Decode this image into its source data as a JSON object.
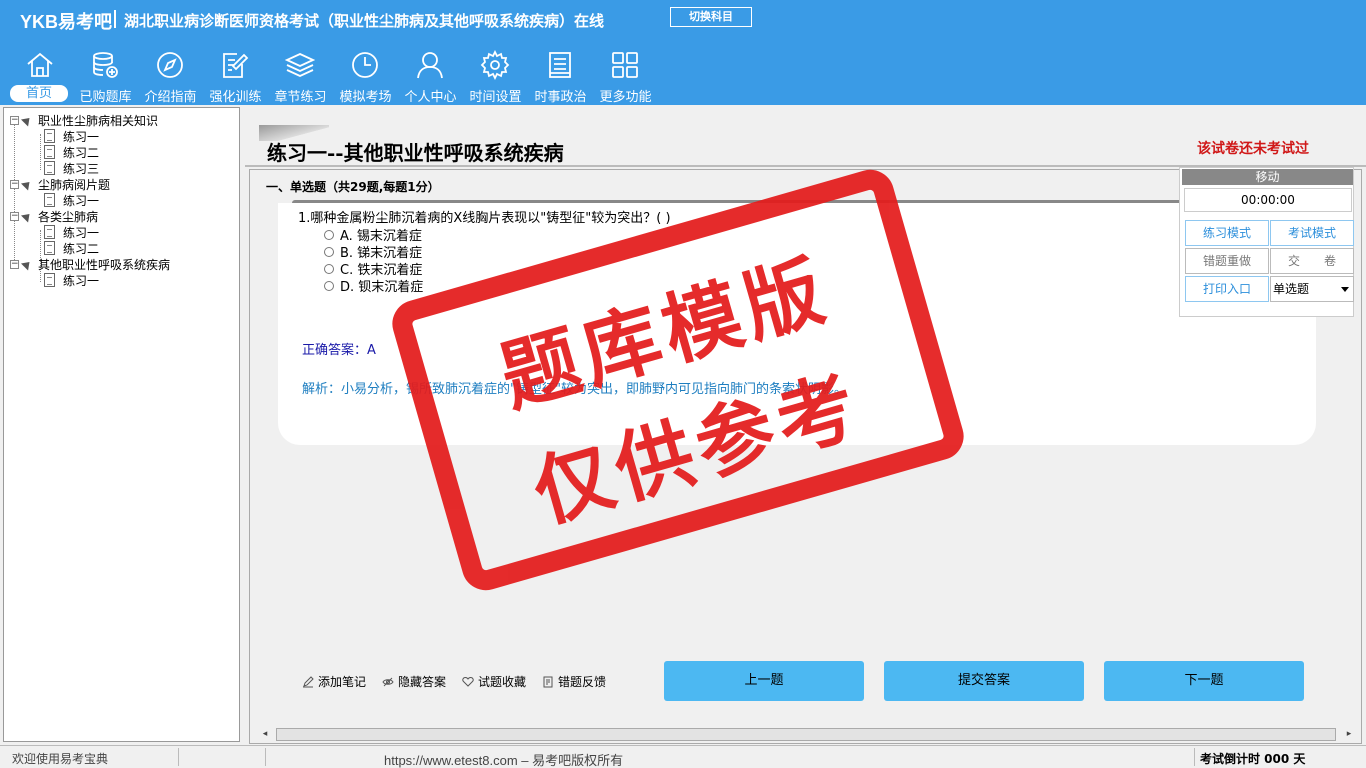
{
  "header": {
    "logo": "YKB易考吧",
    "title": "湖北职业病诊断医师资格考试（职业性尘肺病及其他呼吸系统疾病）在线",
    "switch_label": "切换科目",
    "bg_color": "#3a9be6",
    "nav": [
      {
        "label": "首页",
        "icon": "home-icon"
      },
      {
        "label": "已购题库",
        "icon": "database-icon"
      },
      {
        "label": "介绍指南",
        "icon": "compass-icon"
      },
      {
        "label": "强化训练",
        "icon": "edit-icon"
      },
      {
        "label": "章节练习",
        "icon": "layers-icon"
      },
      {
        "label": "模拟考场",
        "icon": "clock-icon"
      },
      {
        "label": "个人中心",
        "icon": "user-icon"
      },
      {
        "label": "时间设置",
        "icon": "gear-icon"
      },
      {
        "label": "时事政治",
        "icon": "notebook-icon"
      },
      {
        "label": "更多功能",
        "icon": "grid-icon"
      }
    ]
  },
  "tree": {
    "groups": [
      {
        "label": "职业性尘肺病相关知识",
        "children": [
          "练习一",
          "练习二",
          "练习三"
        ]
      },
      {
        "label": "尘肺病阅片题",
        "children": [
          "练习一"
        ]
      },
      {
        "label": "各类尘肺病",
        "children": [
          "练习一",
          "练习二"
        ]
      },
      {
        "label": "其他职业性呼吸系统疾病",
        "children": [
          "练习一"
        ]
      }
    ]
  },
  "exercise": {
    "title": "练习一--其他职业性呼吸系统疾病",
    "status": "该试卷还未考试过",
    "section": "一、单选题（共29题,每题1分）",
    "question": "1.哪种金属粉尘肺沉着病的X线胸片表现以\"铸型征\"较为突出？( )",
    "options": [
      "A. 锡末沉着症",
      "B. 锑末沉着症",
      "C. 铁末沉着症",
      "D. 钡末沉着症"
    ],
    "answer": "正确答案：A",
    "analysis": "解析：小易分析，锡所致肺沉着症的\"铸型征\"较为突出，即肺野内可见指向肺门的条索状阴影。"
  },
  "tools": [
    "添加笔记",
    "隐藏答案",
    "试题收藏",
    "错题反馈"
  ],
  "buttons": {
    "prev": "上一题",
    "submit": "提交答案",
    "next": "下一题"
  },
  "float_panel": {
    "head": "移动",
    "timer": "00:00:00",
    "practice_mode": "练习模式",
    "exam_mode": "考试模式",
    "redo_wrong": "错题重做",
    "hand_in": "交　　卷",
    "print": "打印入口",
    "type_select": "单选题"
  },
  "stamp": {
    "line1": "题库模版",
    "line2": "仅供参考"
  },
  "statusbar": {
    "welcome": "欢迎使用易考宝典",
    "copyright": "https://www.etest8.com – 易考吧版权所有",
    "countdown": "考试倒计时 000 天"
  }
}
